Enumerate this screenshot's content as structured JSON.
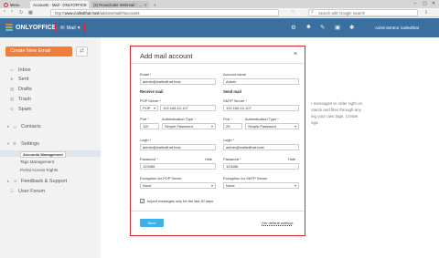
{
  "browser": {
    "menu_label": "Menu",
    "tabs": [
      {
        "title": "Accounts - Mail - ONLYOFFICE"
      },
      {
        "title": "(2) Roundcube Webmail :: ..."
      }
    ],
    "url_prefix": "http://",
    "url_host": "www.icalledthat.host",
    "url_path": "/addons/mail/#accounts",
    "search_placeholder": "Search with Google Search",
    "window_controls": [
      "─",
      "▢",
      "✕"
    ]
  },
  "app": {
    "logo_text": "ONLYOFFICE",
    "module_label": "Mail",
    "admin_name": "Administrator icalledthat",
    "brand_color": "#3a6f9f",
    "header_icons": [
      "gear-icon",
      "people-icon",
      "chat-icon",
      "calendar-icon",
      "bell-icon"
    ]
  },
  "sidebar": {
    "create_button": "Create New Email",
    "folders": [
      {
        "label": "Inbox",
        "icon": "inbox-icon"
      },
      {
        "label": "Sent",
        "icon": "sent-icon"
      },
      {
        "label": "Drafts",
        "icon": "drafts-icon"
      },
      {
        "label": "Trash",
        "icon": "trash-icon"
      },
      {
        "label": "Spam",
        "icon": "spam-icon"
      }
    ],
    "contacts": "Contacts",
    "settings": "Settings",
    "settings_items": [
      "Accounts Management",
      "Tags Management",
      "Portal Access Rights"
    ],
    "feedback": "Feedback & Support",
    "user_forum": "User Forum",
    "accent_color": "#f07d39"
  },
  "background": {
    "lines": [
      "r messages in order right on",
      "ntacts and files through any",
      "ing your own tags. Create",
      "ngs."
    ]
  },
  "modal": {
    "title": "Add mail account",
    "close_glyph": "×",
    "email_label": "Email",
    "email_value": "admin@icalledthat.host",
    "account_name_label": "Account name",
    "account_name_value": "Admin",
    "receive_heading": "Receive mail",
    "send_heading": "Send mail",
    "pop_label": "POP Server",
    "pop_type": "POP",
    "pop_server": "192.168.10.107",
    "smtp_label": "SMTP Server",
    "smtp_server": "192.168.10.107",
    "port_label": "Port",
    "auth_label": "Authentication Type",
    "pop_port": "110",
    "pop_auth": "Simple Password",
    "smtp_port": "25",
    "smtp_auth": "Simple Password",
    "login_label": "Login",
    "pop_login": "admin@icalledthat.host",
    "smtp_login": "admin@icalledthat.host",
    "password_label": "Password",
    "hide_label": "Hide",
    "pop_password": "123456",
    "smtp_password": "123456",
    "enc_pop_label": "Encryption for POP Server",
    "enc_smtp_label": "Encryption for SMTP Server",
    "enc_pop_value": "None",
    "enc_smtp_value": "None",
    "import_label": "Import messages only for the last 30 days",
    "import_checked": true,
    "save_label": "Save",
    "defaults_label": "Get default settings",
    "required_mark": "*",
    "highlight_color": "#e0242c"
  }
}
